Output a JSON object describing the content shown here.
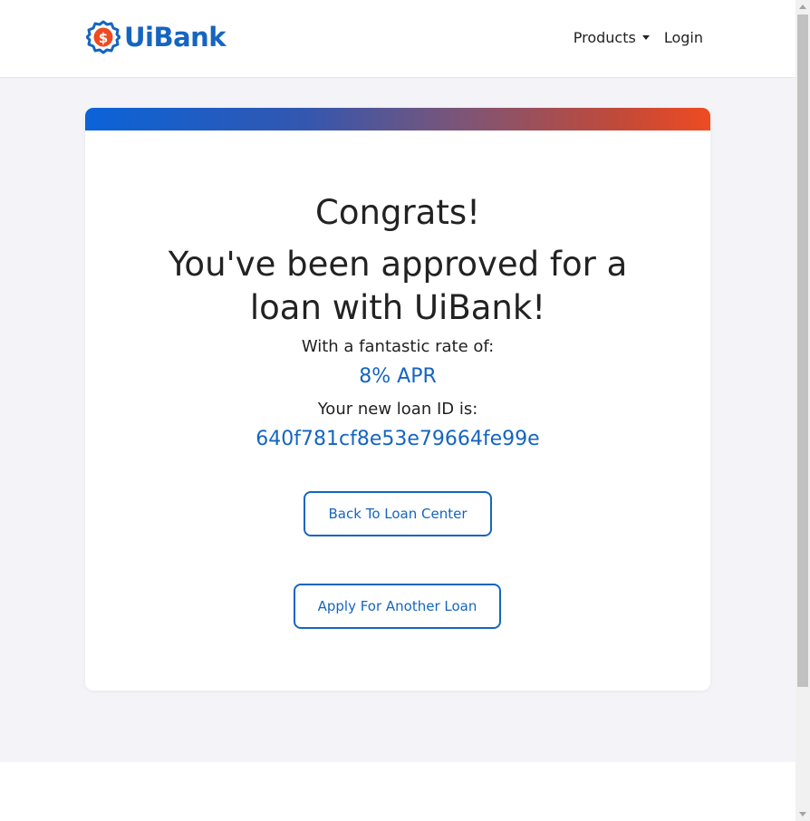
{
  "header": {
    "brand_text": "UiBank",
    "nav": {
      "products_label": "Products",
      "login_label": "Login"
    }
  },
  "main": {
    "congrats": "Congrats!",
    "approved_message": "You've been approved for a loan with UiBank!",
    "rate_label": "With a fantastic rate of:",
    "rate_value": "8% APR",
    "loan_id_label": "Your new loan ID is:",
    "loan_id": "640f781cf8e53e79664fe99e",
    "back_button": "Back To Loan Center",
    "apply_button": "Apply For Another Loan"
  },
  "colors": {
    "brand_blue": "#1565c0",
    "accent_orange": "#ee4b22",
    "page_background": "#f4f4f8"
  },
  "icons": {
    "logo": "dollar-badge-icon",
    "products_caret": "caret-down-icon"
  }
}
